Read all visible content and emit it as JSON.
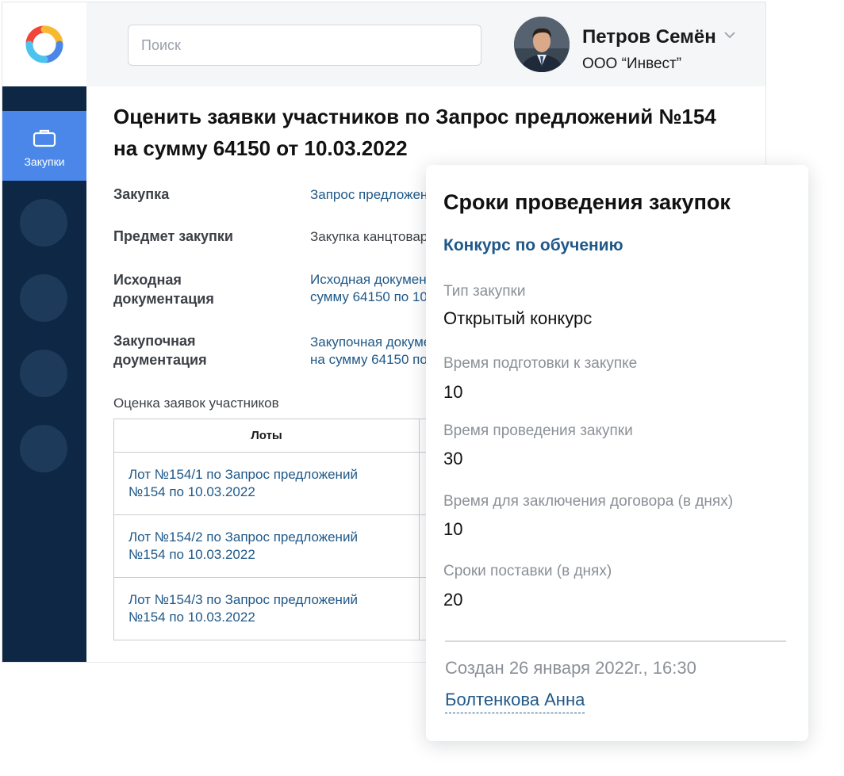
{
  "header": {
    "search_placeholder": "Поиск",
    "user_name": "Петров Семён",
    "user_org": "ООО “Инвест”"
  },
  "sidebar": {
    "active_item_label": "Закупки"
  },
  "main": {
    "title": "Оценить заявки участников по Запрос предложений №154 на сумму 64150 от 10.03.2022",
    "fields": [
      {
        "label": "Закупка",
        "value": "Запрос предложений"
      },
      {
        "label": "Предмет закупки",
        "value": "Закупка канцтоваров"
      },
      {
        "label": "Исходная документация",
        "value_line1": "Исходная документация",
        "value_line2": "сумму 64150 по 10.03.2022"
      },
      {
        "label": "Закупочная доументация",
        "value_line1": "Закупочная документация",
        "value_line2": "на сумму 64150 по 10.03.2022"
      }
    ],
    "section_label": "Оценка заявок участников",
    "table": {
      "header": "Лоты",
      "rows": [
        {
          "line1": "Лот №154/1 по Запрос предложений",
          "line2": "№154 по 10.03.2022"
        },
        {
          "line1": "Лот №154/2 по Запрос предложений",
          "line2": "№154 по 10.03.2022"
        },
        {
          "line1": "Лот №154/3 по Запрос предложений",
          "line2": "№154 по 10.03.2022"
        }
      ]
    }
  },
  "popup": {
    "title": "Сроки проведения закупок",
    "subtitle": "Конкурс по обучению",
    "items": [
      {
        "label": "Тип закупки",
        "value": "Открытый конкурс"
      },
      {
        "label": "Время подготовки к закупке",
        "value": "10"
      },
      {
        "label": "Время проведения закупки",
        "value": "30"
      },
      {
        "label": "Время для заключения договора (в днях)",
        "value": "10"
      },
      {
        "label": "Сроки поставки (в днях)",
        "value": "20"
      }
    ],
    "created": "Создан 26 января 2022г., 16:30",
    "author": "Болтенкова Анна"
  },
  "colors": {
    "sidebar_bg": "#0d2744",
    "sidebar_active": "#4a87e8",
    "link": "#1f5888"
  }
}
